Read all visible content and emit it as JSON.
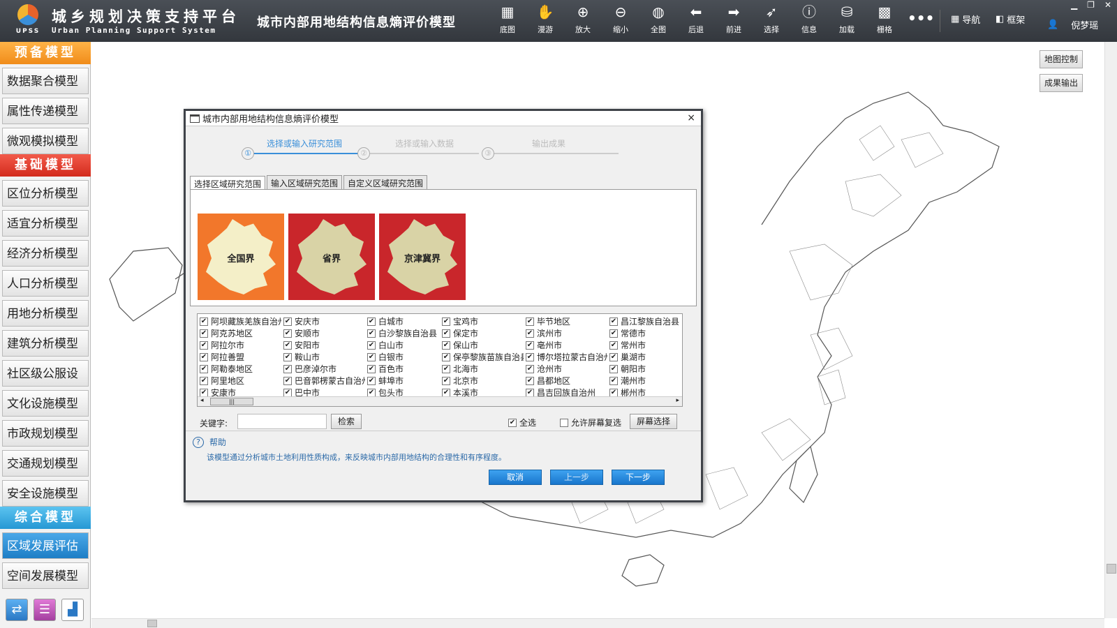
{
  "header": {
    "app_title": "城乡规划决策支持平台",
    "app_subtitle": "Urban Planning Support System",
    "logo_text": "UPSS",
    "model_title": "城市内部用地结构信息熵评价模型",
    "tools": [
      {
        "label": "底图",
        "icon": "basemap-icon",
        "glyph": "▦"
      },
      {
        "label": "漫游",
        "icon": "pan-hand-icon",
        "glyph": "✋"
      },
      {
        "label": "放大",
        "icon": "zoom-in-icon",
        "glyph": "⊕"
      },
      {
        "label": "缩小",
        "icon": "zoom-out-icon",
        "glyph": "⊖"
      },
      {
        "label": "全图",
        "icon": "full-extent-icon",
        "glyph": "◍"
      },
      {
        "label": "后退",
        "icon": "back-arrow-icon",
        "glyph": "⬅"
      },
      {
        "label": "前进",
        "icon": "forward-arrow-icon",
        "glyph": "➡"
      },
      {
        "label": "选择",
        "icon": "select-cursor-icon",
        "glyph": "➶"
      },
      {
        "label": "信息",
        "icon": "info-icon",
        "glyph": "ⓘ"
      },
      {
        "label": "加载",
        "icon": "database-load-icon",
        "glyph": "⛁"
      },
      {
        "label": "栅格",
        "icon": "raster-icon",
        "glyph": "▩"
      }
    ],
    "more": "•••",
    "nav_label": "导航",
    "frame_label": "框架",
    "user_name": "倪梦瑶"
  },
  "sidebar": {
    "sections": [
      {
        "title": "预备模型",
        "color": "orange",
        "items": [
          {
            "label": "数据聚合模型",
            "active": false
          },
          {
            "label": "属性传递模型",
            "active": false
          },
          {
            "label": "微观模拟模型",
            "active": false
          }
        ]
      },
      {
        "title": "基础模型",
        "color": "red",
        "items": [
          {
            "label": "区位分析模型",
            "active": false
          },
          {
            "label": "适宜分析模型",
            "active": false
          },
          {
            "label": "经济分析模型",
            "active": false
          },
          {
            "label": "人口分析模型",
            "active": false
          },
          {
            "label": "用地分析模型",
            "active": false
          },
          {
            "label": "建筑分析模型",
            "active": false
          },
          {
            "label": "社区级公服设",
            "active": false
          },
          {
            "label": "文化设施模型",
            "active": false
          },
          {
            "label": "市政规划模型",
            "active": false
          },
          {
            "label": "交通规划模型",
            "active": false
          },
          {
            "label": "安全设施模型",
            "active": false
          }
        ]
      },
      {
        "title": "综合模型",
        "color": "blue",
        "items": [
          {
            "label": "区域发展评估",
            "active": true
          },
          {
            "label": "空间发展模型",
            "active": false
          }
        ]
      }
    ]
  },
  "map": {
    "control_label": "地图控制",
    "export_label": "成果输出"
  },
  "dialog": {
    "title": "城市内部用地结构信息熵评价模型",
    "close": "×",
    "steps": [
      {
        "num": "①",
        "label": "选择或输入研究范围",
        "active": true
      },
      {
        "num": "②",
        "label": "选择或输入数据",
        "active": false
      },
      {
        "num": "③",
        "label": "输出成果",
        "active": false
      }
    ],
    "tabs": [
      "选择区域研究范围",
      "输入区域研究范围",
      "自定义区域研究范围"
    ],
    "scopes": [
      {
        "label": "全国界",
        "bg": "#f2772b"
      },
      {
        "label": "省界",
        "bg": "#c9262b"
      },
      {
        "label": "京津冀界",
        "bg": "#c9262b"
      }
    ],
    "cities": [
      [
        "阿坝藏族羌族自治州",
        "阿克苏地区",
        "阿拉尔市",
        "阿拉善盟",
        "阿勒泰地区",
        "阿里地区",
        "安康市"
      ],
      [
        "安庆市",
        "安顺市",
        "安阳市",
        "鞍山市",
        "巴彦淖尔市",
        "巴音郭楞蒙古自治州",
        "巴中市"
      ],
      [
        "白城市",
        "白沙黎族自治县",
        "白山市",
        "白银市",
        "百色市",
        "蚌埠市",
        "包头市"
      ],
      [
        "宝鸡市",
        "保定市",
        "保山市",
        "保亭黎族苗族自治县",
        "北海市",
        "北京市",
        "本溪市"
      ],
      [
        "毕节地区",
        "滨州市",
        "亳州市",
        "博尔塔拉蒙古自治州",
        "沧州市",
        "昌都地区",
        "昌吉回族自治州"
      ],
      [
        "昌江黎族自治县",
        "常德市",
        "常州市",
        "巢湖市",
        "朝阳市",
        "潮州市",
        "郴州市"
      ]
    ],
    "keyword_label": "关键字:",
    "keyword_value": "",
    "search_button": "检索",
    "select_all": "全选",
    "allow_screen_multi": "允许屏幕复选",
    "screen_select_button": "屏幕选择",
    "help_title": "帮助",
    "help_text": "该模型通过分析城市土地利用性质构成，来反映城市内部用地结构的合理性和有序程度。",
    "cancel": "取消",
    "prev": "上一步",
    "next": "下一步"
  }
}
